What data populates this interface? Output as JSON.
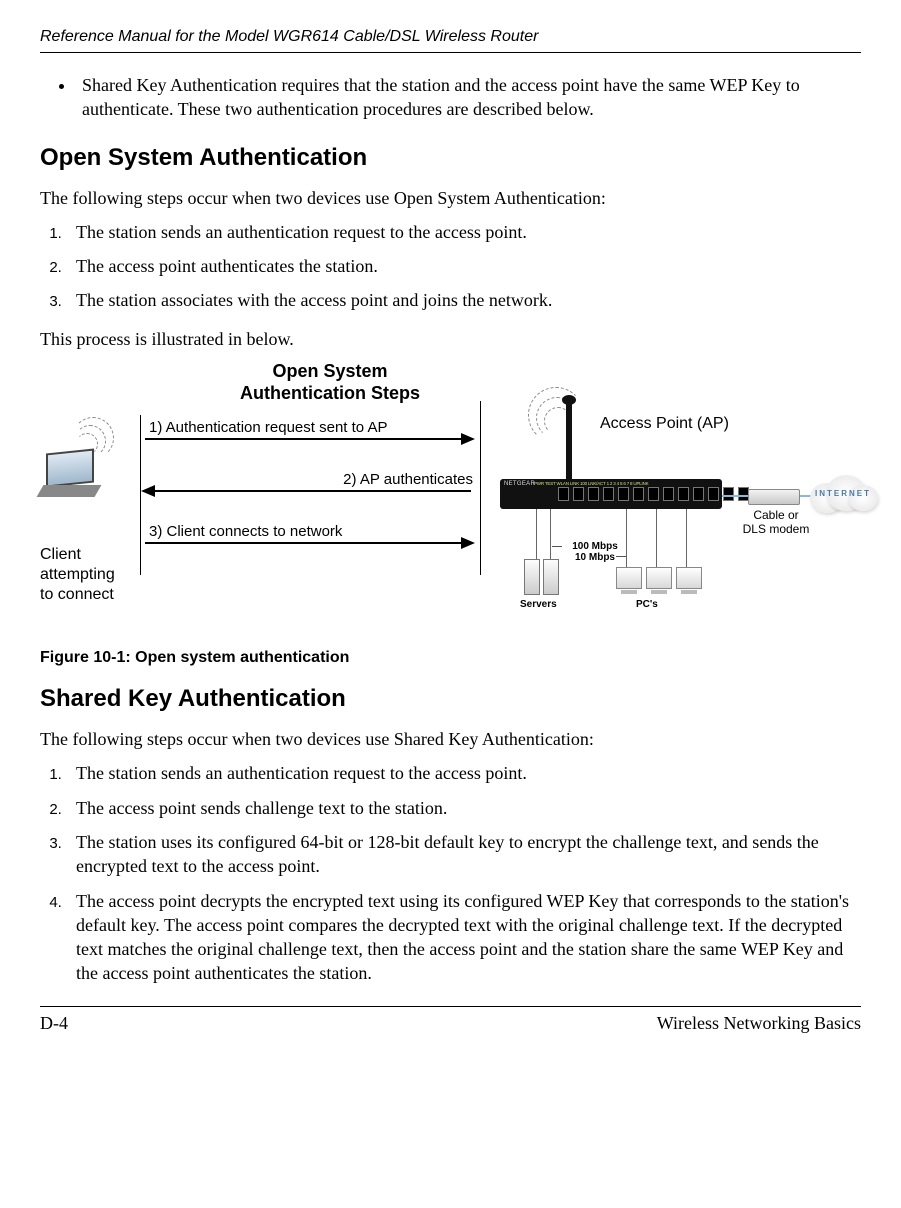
{
  "header": {
    "running_title": "Reference Manual for the Model WGR614 Cable/DSL Wireless Router"
  },
  "bullet": {
    "text": "Shared Key Authentication requires that the station and the access point have the same WEP Key to authenticate. These two authentication procedures are described below."
  },
  "section_open": {
    "heading": "Open System Authentication",
    "intro": "The following steps occur when two devices use Open System Authentication:",
    "steps": [
      "The station sends an authentication request to the access point.",
      "The access point authenticates the station.",
      "The station associates with the access point and joins the network."
    ],
    "after": "This process is illustrated in below."
  },
  "figure": {
    "title_line1": "Open System",
    "title_line2": "Authentication Steps",
    "arrow1": "1) Authentication request sent to AP",
    "arrow2": "2) AP authenticates",
    "arrow3": "3) Client connects to network",
    "client_label_l1": "Client",
    "client_label_l2": "attempting",
    "client_label_l3": "to connect",
    "ap_label": "Access Point (AP)",
    "router_brand": "NETGEAR",
    "port_labels": "PWR  TEST  WLAN  LINK  100  LNK/ACT  1  2  3  4  5  6  7  8  UPLINK",
    "speed_l1": "100 Mbps",
    "speed_l2": "10 Mbps",
    "servers_label": "Servers",
    "pcs_label": "PC's",
    "modem_l1": "Cable or",
    "modem_l2": "DLS modem",
    "cloud_label": "INTERNET",
    "caption": "Figure 10-1: Open system authentication"
  },
  "section_shared": {
    "heading": "Shared Key Authentication",
    "intro": "The following steps occur when two devices use Shared Key Authentication:",
    "steps": [
      "The station sends an authentication request to the access point.",
      "The access point sends challenge text to the station.",
      "The station uses its configured 64-bit or 128-bit default key to encrypt the challenge text, and sends the encrypted text to the access point.",
      "The access point decrypts the encrypted text using its configured WEP Key that corresponds to the station's default key. The access point compares the decrypted text with the original challenge text. If the decrypted text matches the original challenge text, then the access point and the station share the same WEP Key and the access point authenticates the station."
    ]
  },
  "footer": {
    "left": "D-4",
    "right": "Wireless Networking Basics"
  }
}
